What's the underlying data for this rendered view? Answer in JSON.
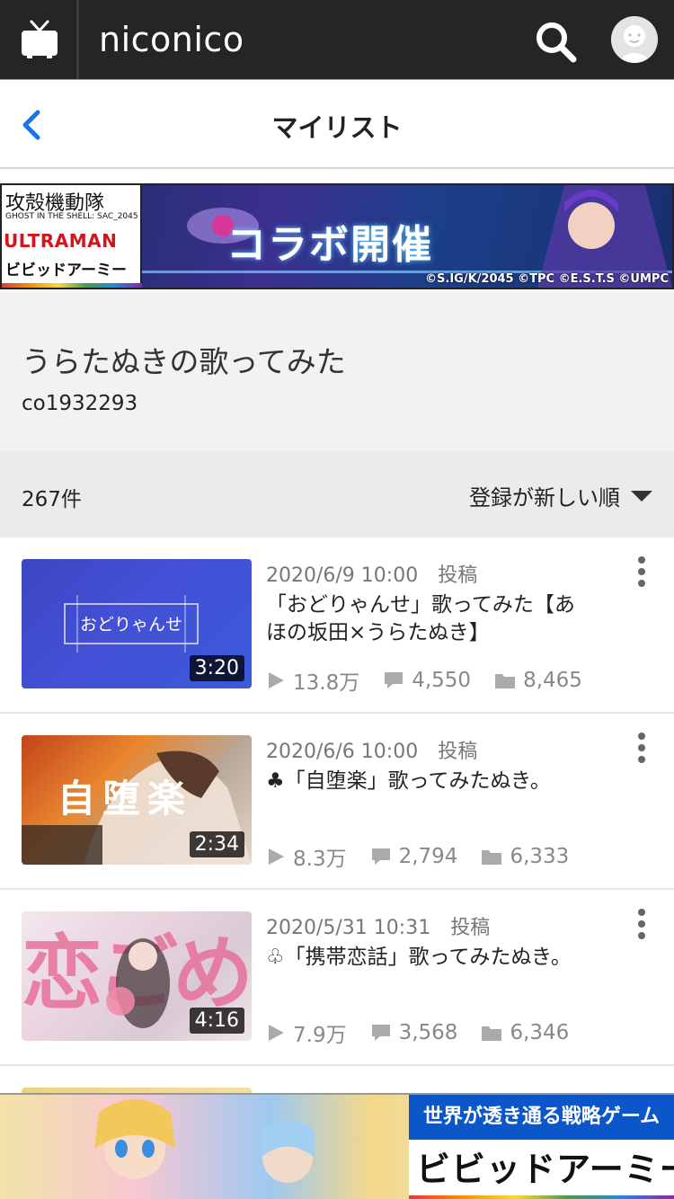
{
  "app": {
    "logo_text": "niconico",
    "icons": {
      "tv": "tv-icon",
      "search": "search-icon",
      "avatar": "avatar-icon"
    }
  },
  "header": {
    "title": "マイリスト",
    "back_icon": "chevron-left-icon"
  },
  "top_banner": {
    "left_title": "攻殻機動隊",
    "left_subtitle": "GHOST IN THE SHELL: SAC_2045",
    "left_collab": "ULTRAMAN",
    "left_game": "ビビッドアーミー",
    "headline": "コラボ開催",
    "credit": "©S.IG/K/2045 ©TPC ©E.S.T.S ©UMPC"
  },
  "mylist": {
    "name": "うらたぬきの歌ってみた",
    "community_id": "co1932293"
  },
  "list_bar": {
    "count": "267件",
    "sort_label": "登録が新しい順"
  },
  "videos": [
    {
      "date": "2020/6/9 10:00　投稿",
      "title": "「おどりゃんせ」歌ってみた【あほの坂田×うらたぬき】",
      "duration": "3:20",
      "thumb_text": "おどりゃんせ",
      "views": "13.8万",
      "comments": "4,550",
      "mylists": "8,465"
    },
    {
      "date": "2020/6/6 10:00　投稿",
      "title": "♣「自堕楽」歌ってみたぬき。",
      "duration": "2:34",
      "thumb_text": "自堕楽",
      "views": "8.3万",
      "comments": "2,794",
      "mylists": "6,333"
    },
    {
      "date": "2020/5/31 10:31　投稿",
      "title": "♧「携帯恋話」歌ってみたぬき。",
      "duration": "4:16",
      "thumb_text": "恋ごめ",
      "views": "7.9万",
      "comments": "3,568",
      "mylists": "6,346"
    }
  ],
  "bottom_ad": {
    "tagline": "世界が透き通る戦略ゲーム",
    "logo": "ビビッドアーミー"
  },
  "colors": {
    "topbar": "#252525",
    "accent_blue": "#1a73e8",
    "stat_gray": "#888888"
  }
}
